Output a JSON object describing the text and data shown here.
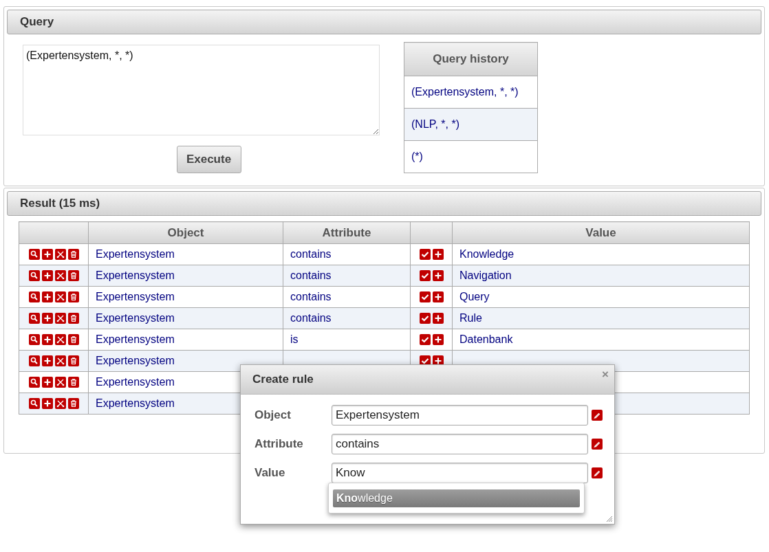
{
  "query_panel": {
    "title": "Query",
    "query_input": {
      "value": "(Expertensystem, *, *)"
    },
    "execute_button": "Execute",
    "history": {
      "title": "Query history",
      "items": [
        {
          "label": "(Expertensystem, *, *)"
        },
        {
          "label": "(NLP, *, *)"
        },
        {
          "label": "(*)"
        }
      ]
    }
  },
  "result_panel": {
    "title": "Result (15 ms)",
    "table": {
      "columns": [
        "Object",
        "Attribute",
        "Value"
      ],
      "rows": [
        {
          "object": "Expertensystem",
          "attribute": "contains",
          "value": "Knowledge"
        },
        {
          "object": "Expertensystem",
          "attribute": "contains",
          "value": "Navigation"
        },
        {
          "object": "Expertensystem",
          "attribute": "contains",
          "value": "Query"
        },
        {
          "object": "Expertensystem",
          "attribute": "contains",
          "value": "Rule"
        },
        {
          "object": "Expertensystem",
          "attribute": "is",
          "value": "Datenbank"
        },
        {
          "object": "Expertensystem"
        },
        {
          "object": "Expertensystem"
        },
        {
          "object": "Expertensystem"
        }
      ]
    }
  },
  "dialog": {
    "title": "Create rule",
    "close": "×",
    "fields": [
      {
        "label": "Object",
        "value": "Expertensystem"
      },
      {
        "label": "Attribute",
        "value": "contains"
      },
      {
        "label": "Value",
        "value": "Know"
      }
    ],
    "suggestions": [
      {
        "label": "**Kno**wledge",
        "selected": true
      }
    ]
  }
}
